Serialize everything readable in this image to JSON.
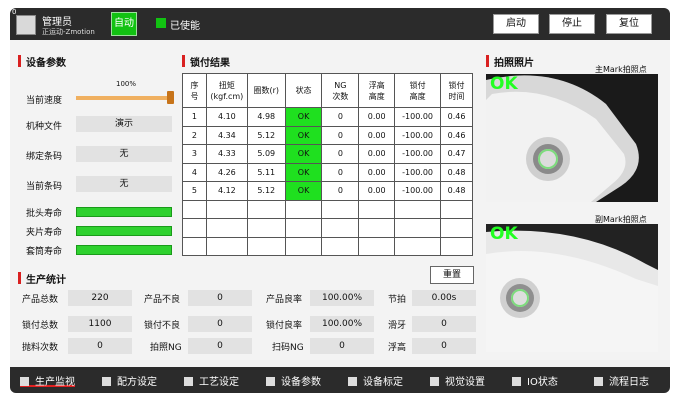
{
  "header": {
    "corner": "0",
    "user_name": "管理员",
    "user_sub": "正运动-Zmotion",
    "mode": "自动",
    "enable_status": "已使能",
    "buttons": [
      "启动",
      "停止",
      "复位"
    ]
  },
  "device": {
    "title": "设备参数",
    "speed_label": "当前速度",
    "speed_percent_text": "100%",
    "speed_value": 100,
    "fields": [
      {
        "label": "机种文件",
        "value": "演示"
      },
      {
        "label": "绑定条码",
        "value": "无"
      },
      {
        "label": "当前条码",
        "value": "无"
      }
    ],
    "life_items": [
      {
        "label": "批头寿命",
        "value": 100
      },
      {
        "label": "夹片寿命",
        "value": 100
      },
      {
        "label": "套筒寿命",
        "value": 100
      }
    ]
  },
  "lock": {
    "title": "锁付结果",
    "headers": [
      [
        "序",
        "号"
      ],
      [
        "扭矩",
        "(kgf.cm)"
      ],
      [
        "圈数(r)"
      ],
      [
        "状态"
      ],
      [
        "NG",
        "次数"
      ],
      [
        "浮高",
        "高度"
      ],
      [
        "锁付",
        "高度"
      ],
      [
        "锁付",
        "时间"
      ]
    ],
    "rows": [
      [
        "1",
        "4.10",
        "4.98",
        "OK",
        "0",
        "0.00",
        "-100.00",
        "0.46"
      ],
      [
        "2",
        "4.34",
        "5.12",
        "OK",
        "0",
        "0.00",
        "-100.00",
        "0.46"
      ],
      [
        "3",
        "4.33",
        "5.09",
        "OK",
        "0",
        "0.00",
        "-100.00",
        "0.47"
      ],
      [
        "4",
        "4.26",
        "5.11",
        "OK",
        "0",
        "0.00",
        "-100.00",
        "0.48"
      ],
      [
        "5",
        "4.12",
        "5.12",
        "OK",
        "0",
        "0.00",
        "-100.00",
        "0.48"
      ]
    ],
    "empty_rows": 3
  },
  "photos": {
    "title": "拍照照片",
    "main_caption": "主Mark拍照点",
    "sub_caption": "副Mark拍照点",
    "main_result": "OK",
    "sub_result": "OK",
    "colors": {
      "ok_text": "#22ff22",
      "ring": "#7ddc7d"
    }
  },
  "production": {
    "title": "生产统计",
    "reset_label": "重置",
    "rows": [
      [
        {
          "label": "产品总数",
          "value": "220"
        },
        {
          "label": "产品不良",
          "value": "0"
        },
        {
          "label": "产品良率",
          "value": "100.00%"
        },
        {
          "label": "节拍",
          "value": "0.00s"
        }
      ],
      [
        {
          "label": "锁付总数",
          "value": "1100"
        },
        {
          "label": "锁付不良",
          "value": "0"
        },
        {
          "label": "锁付良率",
          "value": "100.00%"
        },
        {
          "label": "滑牙",
          "value": "0"
        }
      ],
      [
        {
          "label": "抛料次数",
          "value": "0"
        },
        {
          "label": "拍照NG",
          "value": "0"
        },
        {
          "label": "扫码NG",
          "value": "0"
        },
        {
          "label": "浮高",
          "value": "0"
        }
      ]
    ]
  },
  "nav": {
    "items": [
      "生产监视",
      "配方设定",
      "工艺设定",
      "设备参数",
      "设备标定",
      "视觉设置",
      "IO状态",
      "流程日志"
    ],
    "active_index": 0
  },
  "colors": {
    "accent_red": "#d92020",
    "ok_green": "#1fe01f",
    "bar_dark": "#2b2b2b"
  }
}
